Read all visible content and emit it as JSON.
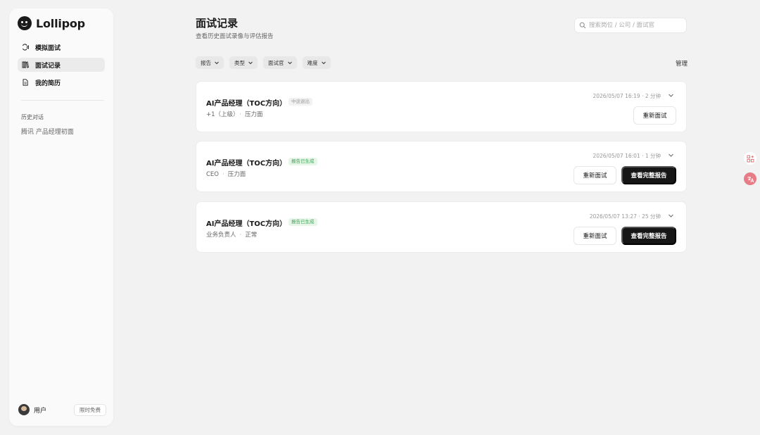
{
  "brand": {
    "name": "Lollipop"
  },
  "sidebar": {
    "items": [
      {
        "label": "模拟面试",
        "icon": "video-icon"
      },
      {
        "label": "面试记录",
        "icon": "book-icon",
        "active": true
      },
      {
        "label": "我的简历",
        "icon": "document-icon"
      }
    ],
    "history_title": "历史对话",
    "history": [
      "腾讯 产品经理初面"
    ],
    "user": {
      "name": "用户",
      "badge": "限时免费"
    }
  },
  "header": {
    "title": "面试记录",
    "subtitle": "查看历史面试录像与评估报告"
  },
  "search": {
    "placeholder": "搜索岗位 / 公司 / 面试官"
  },
  "filters": [
    {
      "label": "报告"
    },
    {
      "label": "类型"
    },
    {
      "label": "面试官"
    },
    {
      "label": "难度"
    }
  ],
  "manage_label": "管理",
  "records": [
    {
      "title": "AI产品经理（TOC方向）",
      "status": "中途退出",
      "status_color": "#999999",
      "meta": [
        "+1（上级）",
        "压力面"
      ],
      "time": "2026/05/07 16:19 · 2 分钟",
      "buttons": {
        "retry": "重新面试"
      }
    },
    {
      "title": "AI产品经理（TOC方向）",
      "status": "报告已生成",
      "status_color": "#3ca354",
      "meta": [
        "CEO",
        "压力面"
      ],
      "time": "2026/05/07 16:01 · 1 分钟",
      "buttons": {
        "retry": "重新面试",
        "report": "查看完整报告"
      }
    },
    {
      "title": "AI产品经理（TOC方向）",
      "status": "报告已生成",
      "status_color": "#3ca354",
      "meta": [
        "业务负责人",
        "正常"
      ],
      "time": "2026/05/07 13:27 · 25 分钟",
      "buttons": {
        "retry": "重新面试",
        "report": "查看完整报告"
      }
    }
  ]
}
